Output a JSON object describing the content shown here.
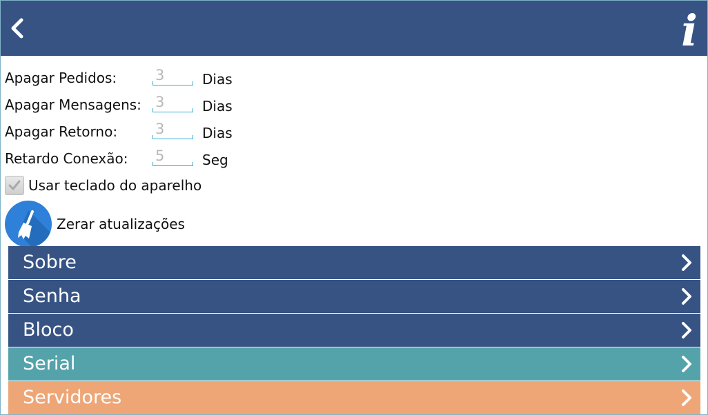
{
  "header": {
    "back_icon": "chevron-left-icon",
    "info_icon": "info-icon",
    "info_glyph": "i",
    "background": "#365383"
  },
  "settings": [
    {
      "label": "Apagar Pedidos:",
      "value": "3",
      "unit": "Dias"
    },
    {
      "label": "Apagar Mensagens:",
      "value": "3",
      "unit": "Dias"
    },
    {
      "label": "Apagar Retorno:",
      "value": "3",
      "unit": "Dias"
    },
    {
      "label": "Retardo Conexão:",
      "value": "5",
      "unit": "Seg"
    }
  ],
  "keyboard_option": {
    "label": "Usar teclado do aparelho",
    "checked": true
  },
  "reset_action": {
    "label": "Zerar atualizações",
    "icon": "broom-icon"
  },
  "menu": [
    {
      "label": "Sobre",
      "color": "#365383"
    },
    {
      "label": "Senha",
      "color": "#365383"
    },
    {
      "label": "Bloco",
      "color": "#365383"
    },
    {
      "label": "Serial",
      "color": "#55a3aa"
    },
    {
      "label": "Servidores",
      "color": "#eea676"
    }
  ],
  "colors": {
    "primary": "#365383",
    "accent": "#31a7d6",
    "teal": "#55a3aa",
    "orange": "#eea676",
    "icon_blue": "#2f80d9"
  }
}
